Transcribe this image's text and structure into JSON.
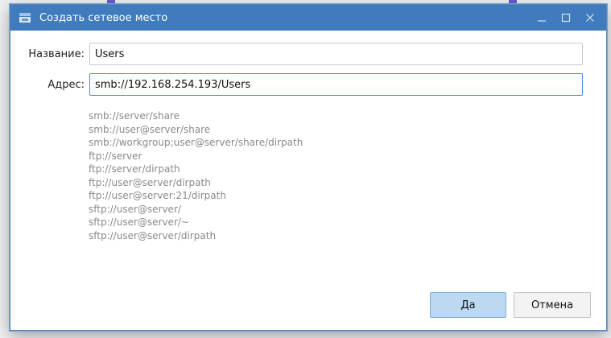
{
  "window": {
    "title": "Создать сетевое место",
    "icon": "network-folder-icon"
  },
  "form": {
    "name_label": "Название:",
    "name_value": "Users",
    "address_label": "Адрес:",
    "address_value": "smb://192.168.254.193/Users"
  },
  "examples": [
    "smb://server/share",
    "smb://user@server/share",
    "smb://workgroup;user@server/share/dirpath",
    "ftp://server",
    "ftp://server/dirpath",
    "ftp://user@server/dirpath",
    "ftp://user@server:21/dirpath",
    "sftp://user@server/",
    "sftp://user@server/~",
    "sftp://user@server/dirpath"
  ],
  "buttons": {
    "ok": "Да",
    "cancel": "Отмена"
  },
  "colors": {
    "titlebar": "#3f7bbd",
    "ok_button": "#bcd9f1",
    "focus_border": "#4a8fd6"
  }
}
